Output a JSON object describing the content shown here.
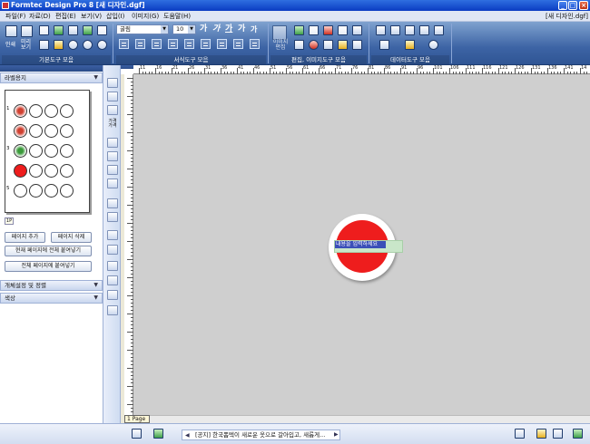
{
  "window": {
    "title": "Formtec Design Pro 8 [새 디자인.dgf]",
    "doc_tab": "[새 디자인.dgf]"
  },
  "menu": [
    "파일(F)",
    "자료(D)",
    "편집(E)",
    "보기(V)",
    "삽입(I)",
    "이미지(G)",
    "도움말(H)"
  ],
  "toolbar": {
    "print_label": "인쇄",
    "preview_label": "미리\n보기",
    "groups": [
      "기본도구 모음",
      "서식도구 모음",
      "편집, 이미지도구 모음",
      "데이터도구 모음"
    ],
    "font_name": "굴림",
    "font_size": "10",
    "format_glyphs": [
      "가",
      "가",
      "가",
      "가",
      "가"
    ],
    "image_edit_label": "이미지\n편집"
  },
  "leftpanel": {
    "header": "라벨용지",
    "rows": [
      "1",
      "3",
      "5"
    ],
    "page_tab": "1P",
    "buttons": {
      "add_page": "페이지 추가",
      "delete_page": "페이지 삭제",
      "paste_current": "현재 페이지에 전체 붙여넣기",
      "paste_all": "전체 페이지에 붙여넣기"
    },
    "section_object": "개체설정 및 정렬",
    "section_color": "색상"
  },
  "tools": {
    "gap_label": "가격\n가격"
  },
  "ruler": {
    "h_numbers": [
      "11",
      "16",
      "21",
      "26",
      "31",
      "36",
      "41",
      "46",
      "51",
      "56",
      "61",
      "66",
      "71",
      "76",
      "81",
      "86",
      "91",
      "96",
      "101",
      "106",
      "111",
      "116",
      "121",
      "126",
      "131",
      "136",
      "141",
      "14"
    ]
  },
  "canvas": {
    "placeholder_text": "내용을 입력하세요",
    "page_tab": "1 Page"
  },
  "status": {
    "notice": "[공지] 한국폼텍이 새로운 옷으로 갈아입고, 새롭게..."
  },
  "colors": {
    "sticker_red": "#ee1d1d",
    "text_highlight": "#3b4fb8",
    "toolbar_blue": "#3d64a5"
  }
}
